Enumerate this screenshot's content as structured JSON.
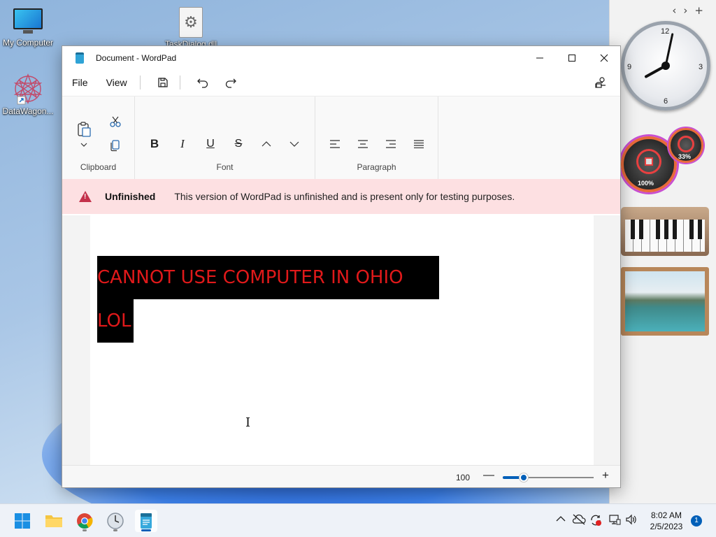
{
  "desktop": {
    "icons": [
      {
        "label": "My Computer"
      },
      {
        "label": "TaskDialog.dll"
      },
      {
        "label": "DataWagon..."
      }
    ]
  },
  "sidebar": {
    "clock_numbers": [
      "12",
      "3",
      "6",
      "9"
    ],
    "clock_time": {
      "hour": 8,
      "minute": 2
    },
    "cpu_meter_label": "100%",
    "ram_meter_label": "33%"
  },
  "window": {
    "title": "Document - WordPad",
    "menu": {
      "file": "File",
      "view": "View"
    },
    "ribbon": {
      "groups": {
        "clipboard": "Clipboard",
        "font": "Font",
        "paragraph": "Paragraph"
      }
    },
    "banner": {
      "title": "Unfinished",
      "message": "This version of WordPad is unfinished and is present only for testing purposes."
    },
    "document": {
      "lines": [
        "CANNOT USE COMPUTER IN OHIO",
        "LOL"
      ],
      "text_color": "#e0191a",
      "highlight_color": "#000000"
    },
    "status": {
      "zoom": "100",
      "zoom_fraction": 0.23
    }
  },
  "taskbar": {
    "time": "8:02 AM",
    "date": "2/5/2023",
    "notification_count": "1"
  },
  "colors": {
    "accent": "#005fb8",
    "banner_bg": "#fde0e2",
    "warning": "#c4314b"
  }
}
